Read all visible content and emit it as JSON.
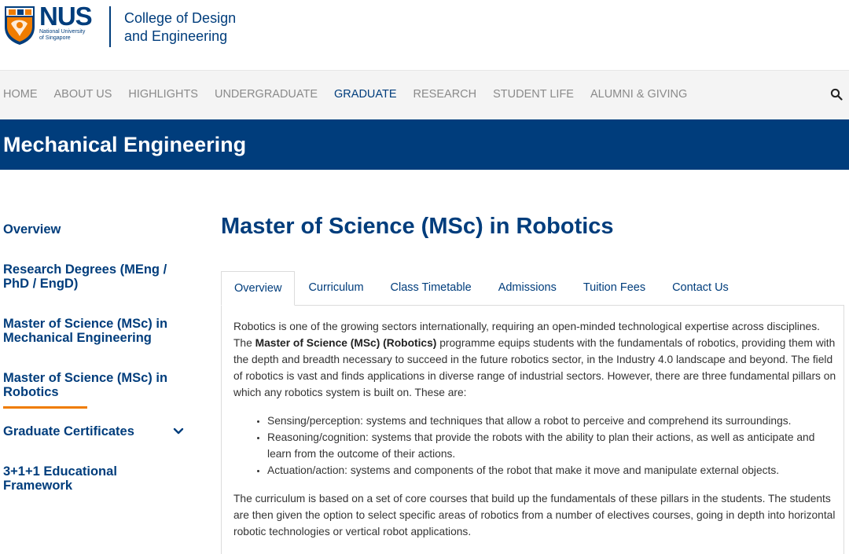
{
  "header": {
    "logo_word": "NUS",
    "logo_sub_line1": "National University",
    "logo_sub_line2": "of Singapore",
    "college_line1": "College of Design",
    "college_line2": "and Engineering"
  },
  "nav": {
    "items": [
      "HOME",
      "ABOUT US",
      "HIGHLIGHTS",
      "UNDERGRADUATE",
      "GRADUATE",
      "RESEARCH",
      "STUDENT LIFE",
      "ALUMNI & GIVING"
    ],
    "active": "GRADUATE",
    "search_icon": "search-icon"
  },
  "banner": {
    "title": "Mechanical Engineering"
  },
  "sidebar": {
    "items": [
      {
        "label": "Overview"
      },
      {
        "label": "Research Degrees (MEng / PhD / EngD)"
      },
      {
        "label": "Master of Science (MSc) in Mechanical Engineering"
      },
      {
        "label": "Master of Science (MSc) in Robotics",
        "active": true
      },
      {
        "label": "Graduate Certificates",
        "expandable": true
      },
      {
        "label": "3+1+1 Educational Framework"
      }
    ]
  },
  "main": {
    "title": "Master of Science (MSc) in Robotics",
    "tabs": [
      "Overview",
      "Curriculum",
      "Class Timetable",
      "Admissions",
      "Tuition Fees",
      "Contact Us"
    ],
    "active_tab": "Overview",
    "intro_before": "Robotics is one of the growing sectors internationally, requiring an open-minded technological expertise across disciplines. The ",
    "intro_bold": "Master of Science (MSc) (Robotics)",
    "intro_after": " programme equips students with the fundamentals of robotics, providing them with the depth and breadth necessary to succeed in the future robotics sector, in the Industry 4.0 landscape and beyond. The field of robotics is vast and finds applications in diverse range of industrial sectors. However, there are three fundamental pillars on which any robotics system is built on. These are:",
    "pillars": [
      "Sensing/perception: systems and techniques that allow a robot to perceive and comprehend its surroundings.",
      "Reasoning/cognition: systems that provide the robots with the ability to plan their actions, as well as anticipate and learn from the outcome of their actions.",
      "Actuation/action: systems and components of the robot that make it move and manipulate external objects."
    ],
    "curriculum_text": "The curriculum is based on a set of core courses that build up the fundamentals of these pillars in the students. The students are then given the option to select specific areas of robotics from a number of electives courses, going in depth into horizontal robotic technologies or vertical robot applications."
  },
  "colors": {
    "brand_blue": "#003D7C",
    "accent_orange": "#EF7C00",
    "nav_bg": "#f4f4f4"
  }
}
